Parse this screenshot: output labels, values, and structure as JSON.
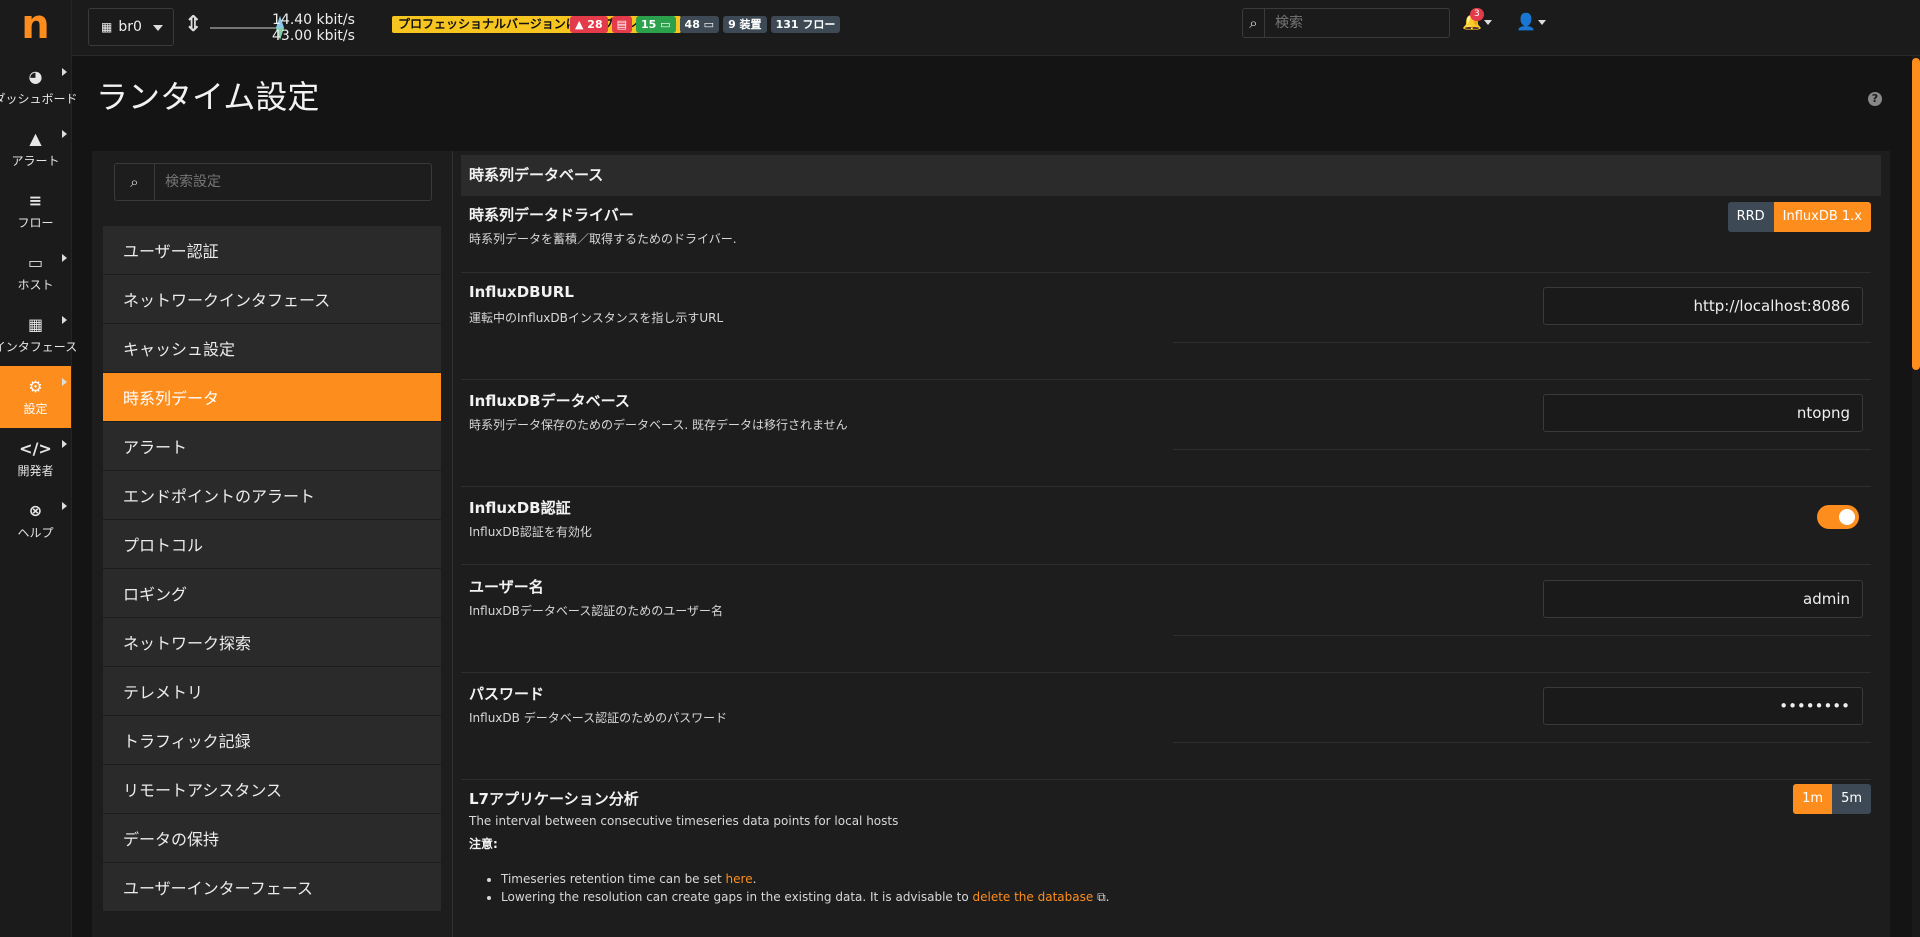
{
  "app": {
    "logo": "n"
  },
  "sidebar": {
    "items": [
      {
        "icon": "gauge-icon",
        "glyph": "◕",
        "label": "ダッシュボード"
      },
      {
        "icon": "warning-icon",
        "glyph": "▲",
        "label": "アラート"
      },
      {
        "icon": "stream-icon",
        "glyph": "≡",
        "label": "フロー"
      },
      {
        "icon": "laptop-icon",
        "glyph": "▭",
        "label": "ホスト"
      },
      {
        "icon": "ethernet-icon",
        "glyph": "▦",
        "label": "インタフェース"
      },
      {
        "icon": "gear-icon",
        "glyph": "⚙",
        "label": "設定"
      },
      {
        "icon": "code-icon",
        "glyph": "</>",
        "label": "開発者"
      },
      {
        "icon": "lifebuoy-icon",
        "glyph": "⊗",
        "label": "ヘルプ"
      }
    ]
  },
  "topbar": {
    "interface": "br0",
    "rate_up": "14.40 kbit/s",
    "rate_down": "43.00 kbit/s",
    "upgrade": "プロフェッショナルバージョンにアップグレード ⧉",
    "badges": {
      "alerts": "▲ 28",
      "db": "▤",
      "hosts_local": "15 ▭",
      "hosts_remote": "48 ▭",
      "devices": "9 装置",
      "flows": "131 フロー"
    },
    "search_placeholder": "検索",
    "notifications": "3"
  },
  "page": {
    "title": "ランタイム設定",
    "settings_search_placeholder": "検索設定"
  },
  "menu": [
    "ユーザー認証",
    "ネットワークインタフェース",
    "キャッシュ設定",
    "時系列データ",
    "アラート",
    "エンドポイントのアラート",
    "プロトコル",
    "ロギング",
    "ネットワーク探索",
    "テレメトリ",
    "トラフィック記録",
    "リモートアシスタンス",
    "データの保持",
    "ユーザーインターフェース"
  ],
  "section": {
    "header": "時系列データベース",
    "driver": {
      "title": "時系列データドライバー",
      "desc": "時系列データを蓄積／取得するためのドライバー.",
      "options": [
        "RRD",
        "InfluxDB 1.x"
      ]
    },
    "url": {
      "title": "InfluxDBURL",
      "desc": "運転中のInfluxDBインスタンスを指し示すURL",
      "value": "http://localhost:8086"
    },
    "database": {
      "title": "InfluxDBデータベース",
      "desc": "時系列データ保存のためのデータベース. 既存データは移行されません",
      "value": "ntopng"
    },
    "auth": {
      "title": "InfluxDB認証",
      "desc": "InfluxDB認証を有効化"
    },
    "username": {
      "title": "ユーザー名",
      "desc": "InfluxDBデータベース認証のためのユーザー名",
      "value": "admin"
    },
    "password": {
      "title": "パスワード",
      "desc": "InfluxDB データベース認証のためのパスワード",
      "value": "••••••••"
    },
    "l7": {
      "title": "L7アプリケーション分析",
      "desc": "The interval between consecutive timeseries data points for local hosts",
      "note_label": "注意:",
      "options": [
        "1m",
        "5m"
      ],
      "bullet1_text": "Timeseries retention time can be set ",
      "bullet1_link": "here",
      "bullet1_end": ".",
      "bullet2_text": "Lowering the resolution can create gaps in the existing data. It is advisable to ",
      "bullet2_link": "delete the database",
      "bullet2_end": " ⧉."
    }
  }
}
